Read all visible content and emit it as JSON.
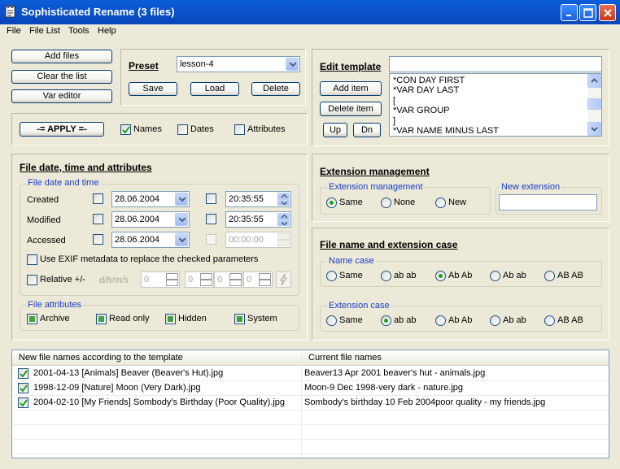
{
  "window": {
    "title": "Sophisticated Rename (3 files)"
  },
  "menu": [
    "File",
    "File List",
    "Tools",
    "Help"
  ],
  "left_buttons": {
    "add_files": "Add files",
    "clear_list": "Clear the list",
    "var_editor": "Var editor"
  },
  "preset": {
    "label": "Preset",
    "value": "lesson-4",
    "save": "Save",
    "load": "Load",
    "delete": "Delete"
  },
  "edit_template": {
    "label": "Edit template",
    "input_value": "",
    "add_item": "Add item",
    "delete_item": "Delete item",
    "up": "Up",
    "dn": "Dn",
    "lines": [
      "*CON DAY FIRST",
      "*VAR DAY LAST",
      "[",
      "*VAR GROUP",
      "]",
      "*VAR NAME MINUS LAST"
    ]
  },
  "apply": {
    "label": "-= APPLY =-",
    "names": {
      "label": "Names",
      "checked": true
    },
    "dates": {
      "label": "Dates",
      "checked": false
    },
    "attributes": {
      "label": "Attributes",
      "checked": false
    }
  },
  "file_date": {
    "title": "File date, time and attributes",
    "group_title": "File date and time",
    "rows": [
      {
        "label": "Created",
        "date": "28.06.2004",
        "time": "20:35:55"
      },
      {
        "label": "Modified",
        "date": "28.06.2004",
        "time": "20:35:55"
      },
      {
        "label": "Accessed",
        "date": "28.06.2004",
        "time": "00:00:00"
      }
    ],
    "exif_label": "Use EXIF metadata to replace the checked parameters",
    "relative_label": "Relative +/-",
    "relative_unit": "d/h/m/s",
    "relative_values": [
      "0",
      "0",
      "0",
      "0"
    ]
  },
  "file_attributes": {
    "group_title": "File attributes",
    "items": [
      "Archive",
      "Read only",
      "Hidden",
      "System"
    ]
  },
  "extension_mgmt": {
    "title": "Extension management",
    "group_title": "Extension management",
    "options": [
      "Same",
      "None",
      "New"
    ],
    "selected": "Same",
    "new_ext_title": "New extension",
    "new_ext_value": ""
  },
  "case": {
    "title": "File name and extension case",
    "name_case_title": "Name case",
    "ext_case_title": "Extension case",
    "options": [
      "Same",
      "ab ab",
      "Ab Ab",
      "Ab ab",
      "AB AB"
    ],
    "name_selected": "Ab Ab",
    "ext_selected": "ab ab"
  },
  "file_list": {
    "headers": [
      "New file names according to the template",
      "Current file names"
    ],
    "rows": [
      {
        "new": "2001-04-13 [Animals] Beaver (Beaver's Hut).jpg",
        "current": "Beaver13 Apr 2001 beaver's hut - animals.jpg"
      },
      {
        "new": "1998-12-09 [Nature] Moon (Very Dark).jpg",
        "current": "Moon-9 Dec 1998-very dark - nature.jpg"
      },
      {
        "new": "2004-02-10 [My Friends] Sombody's Birthday (Poor Quality).jpg",
        "current": "Sombody's birthday 10 Feb 2004poor quality - my friends.jpg"
      }
    ]
  },
  "icons": {
    "app": "notepad-icon",
    "minimize": "minimize-icon",
    "maximize": "maximize-icon",
    "close": "close-icon",
    "lightning": "lightning-icon"
  }
}
